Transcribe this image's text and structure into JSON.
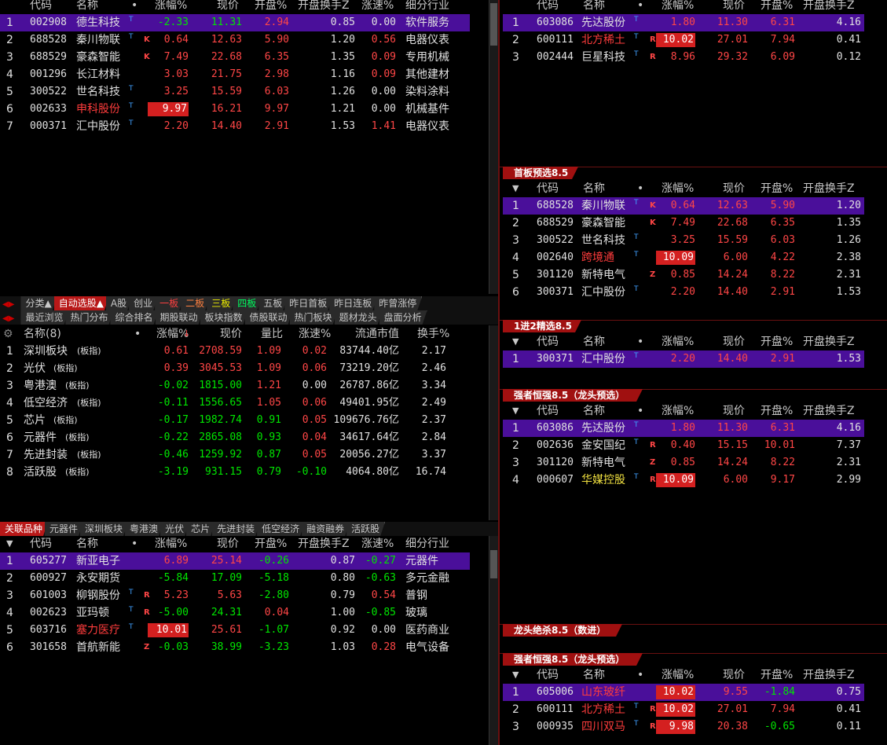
{
  "colors": {
    "up": "#ff4646",
    "down": "#00e600",
    "selected": "#4a0f9a",
    "limit_bg": "#d42020"
  },
  "main": {
    "header": {
      "code": "代码",
      "name": "名称",
      "dot": "•",
      "chg": "涨幅%",
      "price": "现价",
      "open": "开盘%",
      "turn": "开盘换手Z",
      "speed": "涨速%",
      "ind": "细分行业"
    },
    "rows": [
      {
        "idx": "1",
        "code": "002908",
        "name": "德生科技",
        "mark": "T",
        "chg": "-2.33",
        "price": "11.31",
        "open": "2.94",
        "turn": "0.85",
        "speed": "0.00",
        "ind": "软件服务"
      },
      {
        "idx": "2",
        "code": "688528",
        "name": "秦川物联",
        "mark": "T",
        "k": "K",
        "chg": "0.64",
        "price": "12.63",
        "open": "5.90",
        "turn": "1.20",
        "speed": "0.56",
        "ind": "电器仪表"
      },
      {
        "idx": "3",
        "code": "688529",
        "name": "豪森智能",
        "k": "K",
        "chg": "7.49",
        "price": "22.68",
        "open": "6.35",
        "turn": "1.35",
        "speed": "0.09",
        "ind": "专用机械"
      },
      {
        "idx": "4",
        "code": "001296",
        "name": "长江材料",
        "chg": "3.03",
        "price": "21.75",
        "open": "2.98",
        "turn": "1.16",
        "speed": "0.09",
        "ind": "其他建材"
      },
      {
        "idx": "5",
        "code": "300522",
        "name": "世名科技",
        "mark": "T",
        "chg": "3.25",
        "price": "15.59",
        "open": "6.03",
        "turn": "1.26",
        "speed": "0.00",
        "ind": "染料涂料"
      },
      {
        "idx": "6",
        "code": "002633",
        "name": "申科股份",
        "mark": "T",
        "chg": "9.97",
        "price": "16.21",
        "open": "9.97",
        "turn": "1.21",
        "speed": "0.00",
        "ind": "机械基件"
      },
      {
        "idx": "7",
        "code": "000371",
        "name": "汇中股份",
        "mark": "T",
        "chg": "2.20",
        "price": "14.40",
        "open": "2.91",
        "turn": "1.53",
        "speed": "1.41",
        "ind": "电器仪表"
      }
    ]
  },
  "tabs1": [
    "分类▲",
    "自动选股▲",
    "A股",
    "创业",
    "一板",
    "二板",
    "三板",
    "四板",
    "五板",
    "昨日首板",
    "昨日连板",
    "昨曾涨停"
  ],
  "tabs2": [
    "最近浏览",
    "热门分布",
    "综合排名",
    "期股联动",
    "板块指数",
    "债股联动",
    "热门板块",
    "题材龙头",
    "盘面分析"
  ],
  "sector": {
    "header": {
      "name": "名称(8)",
      "dot": "•",
      "chg": "涨幅%",
      "price": "现价",
      "vr": "量比",
      "speed": "涨速%",
      "cap": "流通市值",
      "turn": "换手%"
    },
    "rows": [
      {
        "idx": "1",
        "name": "深圳板块",
        "tag": "(板指)",
        "chg": "0.61",
        "price": "2708.59",
        "vr": "1.09",
        "speed": "0.02",
        "cap": "83744.40亿",
        "turn": "2.17"
      },
      {
        "idx": "2",
        "name": "光伏",
        "tag": "(板指)",
        "chg": "0.39",
        "price": "3045.53",
        "vr": "1.09",
        "speed": "0.06",
        "cap": "73219.20亿",
        "turn": "2.46"
      },
      {
        "idx": "3",
        "name": "粤港澳",
        "tag": "(板指)",
        "chg": "-0.02",
        "price": "1815.00",
        "vr": "1.21",
        "speed": "0.00",
        "cap": "26787.86亿",
        "turn": "3.34"
      },
      {
        "idx": "4",
        "name": "低空经济",
        "tag": "(板指)",
        "chg": "-0.11",
        "price": "1556.65",
        "vr": "1.05",
        "speed": "0.06",
        "cap": "49401.95亿",
        "turn": "2.49"
      },
      {
        "idx": "5",
        "name": "芯片",
        "tag": "(板指)",
        "chg": "-0.17",
        "price": "1982.74",
        "vr": "0.91",
        "speed": "0.05",
        "cap": "109676.76亿",
        "turn": "2.37"
      },
      {
        "idx": "6",
        "name": "元器件",
        "tag": "(板指)",
        "chg": "-0.22",
        "price": "2865.08",
        "vr": "0.93",
        "speed": "0.04",
        "cap": "34617.64亿",
        "turn": "2.84"
      },
      {
        "idx": "7",
        "name": "先进封装",
        "tag": "(板指)",
        "chg": "-0.46",
        "price": "1259.92",
        "vr": "0.87",
        "speed": "0.05",
        "cap": "20056.27亿",
        "turn": "3.37"
      },
      {
        "idx": "8",
        "name": "活跃股",
        "tag": "(板指)",
        "chg": "-3.19",
        "price": "931.15",
        "vr": "0.79",
        "speed": "-0.10",
        "cap": "4064.80亿",
        "turn": "16.74"
      }
    ]
  },
  "tabs3": [
    "关联品种",
    "元器件",
    "深圳板块",
    "粤港澳",
    "光伏",
    "芯片",
    "先进封装",
    "低空经济",
    "融资融券",
    "活跃股"
  ],
  "related": {
    "rows": [
      {
        "idx": "1",
        "code": "605277",
        "name": "新亚电子",
        "chg": "6.89",
        "price": "25.14",
        "open": "-0.26",
        "turn": "0.87",
        "speed": "-0.27",
        "ind": "元器件"
      },
      {
        "idx": "2",
        "code": "600927",
        "name": "永安期货",
        "chg": "-5.84",
        "price": "17.09",
        "open": "-5.18",
        "turn": "0.80",
        "speed": "-0.63",
        "ind": "多元金融"
      },
      {
        "idx": "3",
        "code": "601003",
        "name": "柳钢股份",
        "mark": "T",
        "k": "R",
        "chg": "5.23",
        "price": "5.63",
        "open": "-2.80",
        "turn": "0.79",
        "speed": "0.54",
        "ind": "普钢"
      },
      {
        "idx": "4",
        "code": "002623",
        "name": "亚玛顿",
        "mark": "T",
        "k": "R",
        "chg": "-5.00",
        "price": "24.31",
        "open": "0.04",
        "turn": "1.00",
        "speed": "-0.85",
        "ind": "玻璃"
      },
      {
        "idx": "5",
        "code": "603716",
        "name": "塞力医疗",
        "mark": "T",
        "chg": "10.01",
        "price": "25.61",
        "open": "-1.07",
        "turn": "0.92",
        "speed": "0.00",
        "ind": "医药商业"
      },
      {
        "idx": "6",
        "code": "301658",
        "name": "首航新能",
        "k": "Z",
        "chg": "-0.03",
        "price": "38.99",
        "open": "-3.23",
        "turn": "1.03",
        "speed": "0.28",
        "ind": "电气设备"
      }
    ]
  },
  "right": {
    "header": {
      "code": "代码",
      "name": "名称",
      "dot": "•",
      "chg": "涨幅%",
      "price": "现价",
      "open": "开盘%",
      "turn": "开盘换手Z"
    },
    "top": [
      {
        "idx": "1",
        "code": "603086",
        "name": "先达股份",
        "mark": "T",
        "chg": "1.80",
        "price": "11.30",
        "open": "6.31",
        "turn": "4.16"
      },
      {
        "idx": "2",
        "code": "600111",
        "name": "北方稀土",
        "mark": "T",
        "k": "R",
        "chg": "10.02",
        "price": "27.01",
        "open": "7.94",
        "turn": "0.41"
      },
      {
        "idx": "3",
        "code": "002444",
        "name": "巨星科技",
        "mark": "T",
        "k": "R",
        "chg": "8.96",
        "price": "29.32",
        "open": "6.09",
        "turn": "0.12"
      }
    ],
    "s1_title": "首板预选8.5",
    "s1": [
      {
        "idx": "1",
        "code": "688528",
        "name": "秦川物联",
        "mark": "T",
        "k": "K",
        "chg": "0.64",
        "price": "12.63",
        "open": "5.90",
        "turn": "1.20"
      },
      {
        "idx": "2",
        "code": "688529",
        "name": "豪森智能",
        "k": "K",
        "chg": "7.49",
        "price": "22.68",
        "open": "6.35",
        "turn": "1.35"
      },
      {
        "idx": "3",
        "code": "300522",
        "name": "世名科技",
        "mark": "T",
        "chg": "3.25",
        "price": "15.59",
        "open": "6.03",
        "turn": "1.26"
      },
      {
        "idx": "4",
        "code": "002640",
        "name": "跨境通",
        "mark": "T",
        "chg": "10.09",
        "price": "6.00",
        "open": "4.22",
        "turn": "2.38"
      },
      {
        "idx": "5",
        "code": "301120",
        "name": "新特电气",
        "k": "Z",
        "chg": "0.85",
        "price": "14.24",
        "open": "8.22",
        "turn": "2.31"
      },
      {
        "idx": "6",
        "code": "300371",
        "name": "汇中股份",
        "mark": "T",
        "chg": "2.20",
        "price": "14.40",
        "open": "2.91",
        "turn": "1.53"
      }
    ],
    "s2_title": "1进2精选8.5",
    "s2": [
      {
        "idx": "1",
        "code": "300371",
        "name": "汇中股份",
        "mark": "T",
        "chg": "2.20",
        "price": "14.40",
        "open": "2.91",
        "turn": "1.53"
      }
    ],
    "s3_title": "强者恒强8.5（龙头预选）",
    "s3": [
      {
        "idx": "1",
        "code": "603086",
        "name": "先达股份",
        "mark": "T",
        "chg": "1.80",
        "price": "11.30",
        "open": "6.31",
        "turn": "4.16"
      },
      {
        "idx": "2",
        "code": "002636",
        "name": "金安国纪",
        "mark": "T",
        "k": "R",
        "chg": "0.40",
        "price": "15.15",
        "open": "10.01",
        "turn": "7.37"
      },
      {
        "idx": "3",
        "code": "301120",
        "name": "新特电气",
        "k": "Z",
        "chg": "0.85",
        "price": "14.24",
        "open": "8.22",
        "turn": "2.31"
      },
      {
        "idx": "4",
        "code": "000607",
        "name": "华媒控股",
        "mark": "T",
        "k": "R",
        "chg": "10.09",
        "price": "6.00",
        "open": "9.17",
        "turn": "2.99"
      }
    ],
    "s4_title": "龙头绝杀8.5（数进）",
    "s5_title": "强者恒强8.5（龙头预选）",
    "s5": [
      {
        "idx": "1",
        "code": "605006",
        "name": "山东玻纤",
        "chg": "10.02",
        "price": "9.55",
        "open": "-1.84",
        "turn": "0.75"
      },
      {
        "idx": "2",
        "code": "600111",
        "name": "北方稀土",
        "mark": "T",
        "k": "R",
        "chg": "10.02",
        "price": "27.01",
        "open": "7.94",
        "turn": "0.41"
      },
      {
        "idx": "3",
        "code": "000935",
        "name": "四川双马",
        "mark": "T",
        "k": "R",
        "chg": "9.98",
        "price": "20.38",
        "open": "-0.65",
        "turn": "0.11"
      }
    ]
  }
}
